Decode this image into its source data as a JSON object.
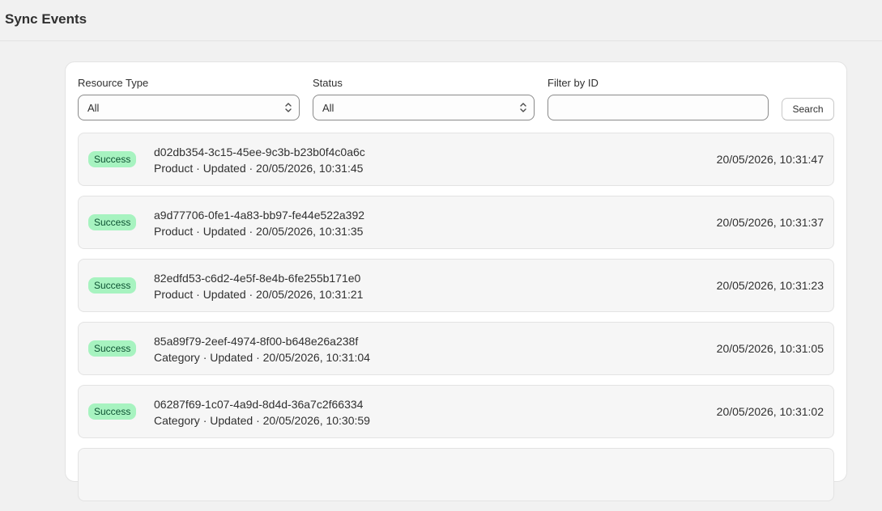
{
  "page": {
    "title": "Sync Events"
  },
  "filters": {
    "resource_type": {
      "label": "Resource Type",
      "value": "All"
    },
    "status": {
      "label": "Status",
      "value": "All"
    },
    "filter_id": {
      "label": "Filter by ID",
      "value": "",
      "placeholder": ""
    },
    "search_label": "Search"
  },
  "colors": {
    "success_badge_bg": "#a7f3c0",
    "success_badge_text": "#0c5132"
  },
  "events": [
    {
      "status": "Success",
      "id": "d02db354-3c15-45ee-9c3b-b23b0f4c0a6c",
      "meta": "Product · Updated · 20/05/2026, 10:31:45",
      "timestamp": "20/05/2026, 10:31:47"
    },
    {
      "status": "Success",
      "id": "a9d77706-0fe1-4a83-bb97-fe44e522a392",
      "meta": "Product · Updated · 20/05/2026, 10:31:35",
      "timestamp": "20/05/2026, 10:31:37"
    },
    {
      "status": "Success",
      "id": "82edfd53-c6d2-4e5f-8e4b-6fe255b171e0",
      "meta": "Product · Updated · 20/05/2026, 10:31:21",
      "timestamp": "20/05/2026, 10:31:23"
    },
    {
      "status": "Success",
      "id": "85a89f79-2eef-4974-8f00-b648e26a238f",
      "meta": "Category · Updated · 20/05/2026, 10:31:04",
      "timestamp": "20/05/2026, 10:31:05"
    },
    {
      "status": "Success",
      "id": "06287f69-1c07-4a9d-8d4d-36a7c2f66334",
      "meta": "Category · Updated · 20/05/2026, 10:30:59",
      "timestamp": "20/05/2026, 10:31:02"
    },
    {
      "status": "",
      "id": "",
      "meta": "",
      "timestamp": ""
    }
  ]
}
